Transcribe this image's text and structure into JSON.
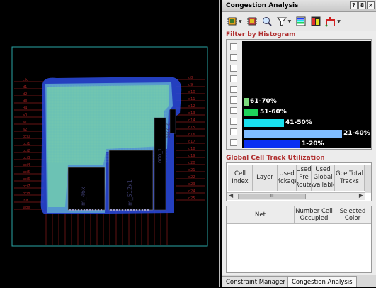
{
  "layout": {
    "pin_labels_left": [
      "clk",
      "d1",
      "d2",
      "d3",
      "d4",
      "a0",
      "a1",
      "a2",
      "pci0",
      "pci1",
      "pci2",
      "pci3",
      "pci4",
      "pci5",
      "pci6",
      "pci7",
      "pci8",
      "init",
      "wbe"
    ],
    "pin_labels_right": [
      "d8",
      "d9",
      "d10",
      "d11",
      "d12",
      "d13",
      "d14",
      "d15",
      "d16",
      "d17",
      "d18",
      "d19",
      "d20",
      "d21",
      "d22",
      "d23",
      "d24",
      "d25"
    ],
    "macro_labels": [
      "m_46x",
      "m_512x1",
      "000_1",
      "0100_0"
    ]
  },
  "panel": {
    "title": "Congestion Analysis",
    "title_buttons": [
      "?",
      "8",
      "×"
    ],
    "filter_label": "Filter by Histogram",
    "histogram": [
      {
        "label": "",
        "fraction": 0,
        "color": "#000000"
      },
      {
        "label": "",
        "fraction": 0,
        "color": "#000000"
      },
      {
        "label": "",
        "fraction": 0,
        "color": "#000000"
      },
      {
        "label": "",
        "fraction": 0,
        "color": "#000000"
      },
      {
        "label": "",
        "fraction": 0,
        "color": "#000000"
      },
      {
        "label": "61-70%",
        "fraction": 0.04,
        "color": "#7ddb7d"
      },
      {
        "label": "51-60%",
        "fraction": 0.12,
        "color": "#1ed45b"
      },
      {
        "label": "41-50%",
        "fraction": 0.32,
        "color": "#19e0ee"
      },
      {
        "label": "21-40%",
        "fraction": 0.78,
        "color": "#7fbcff"
      },
      {
        "label": "1-20%",
        "fraction": 0.45,
        "color": "#0a2ff2"
      }
    ],
    "global_label": "Global Cell Track Utilization",
    "grid_headers": [
      "Cell Index",
      "Layer",
      "Used Pickage",
      "Used Pre Route",
      "Used Global Available",
      "Gce Total Tracks"
    ],
    "scroll_text": "III",
    "table_headers": [
      "Net",
      "Number Cell Occupied",
      "Selected Color"
    ],
    "tabs": [
      "Constraint Manager",
      "Congestion Analysis"
    ],
    "active_tab": "Congestion Analysis"
  }
}
